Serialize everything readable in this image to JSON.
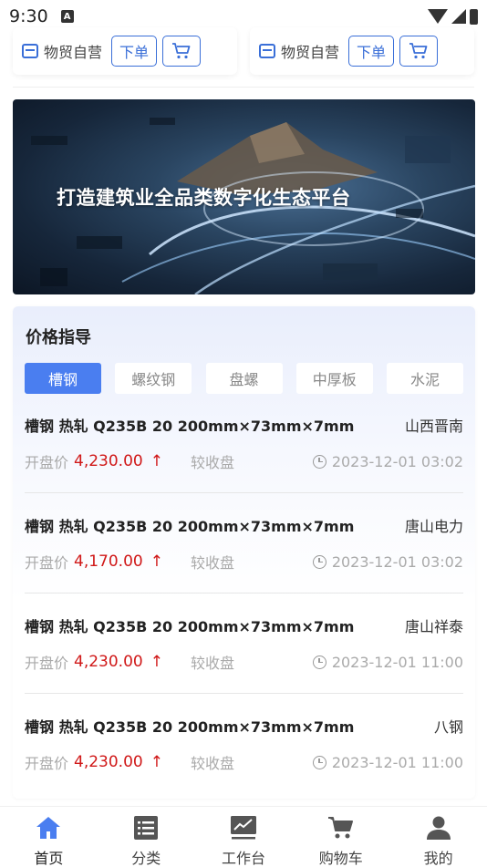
{
  "status_bar": {
    "time": "9:30",
    "notification_glyph": "A"
  },
  "top_cards": [
    {
      "shop_label": "物贸自营",
      "order_label": "下单"
    },
    {
      "shop_label": "物贸自营",
      "order_label": "下单"
    }
  ],
  "banner": {
    "title": "打造建筑业全品类数字化生态平台"
  },
  "price_guide": {
    "title": "价格指导",
    "tabs": [
      {
        "label": "槽钢",
        "active": true
      },
      {
        "label": "螺纹钢",
        "active": false
      },
      {
        "label": "盘螺",
        "active": false
      },
      {
        "label": "中厚板",
        "active": false
      },
      {
        "label": "水泥",
        "active": false
      }
    ],
    "open_label": "开盘价",
    "compare_label": "较收盘",
    "rows": [
      {
        "product": "槽钢 热轧 Q235B 20 200mm×73mm×7mm",
        "origin": "山西晋南",
        "price": "4,230.00",
        "trend": "↑",
        "time": "2023-12-01 03:02"
      },
      {
        "product": "槽钢 热轧 Q235B 20 200mm×73mm×7mm",
        "origin": "唐山电力",
        "price": "4,170.00",
        "trend": "↑",
        "time": "2023-12-01 03:02"
      },
      {
        "product": "槽钢 热轧 Q235B 20 200mm×73mm×7mm",
        "origin": "唐山祥泰",
        "price": "4,230.00",
        "trend": "↑",
        "time": "2023-12-01 11:00"
      },
      {
        "product": "槽钢 热轧 Q235B 20 200mm×73mm×7mm",
        "origin": "八钢",
        "price": "4,230.00",
        "trend": "↑",
        "time": "2023-12-01 11:00"
      }
    ]
  },
  "bottom_nav": [
    {
      "label": "首页",
      "icon": "home-icon",
      "active": true
    },
    {
      "label": "分类",
      "icon": "list-icon",
      "active": false
    },
    {
      "label": "工作台",
      "icon": "chart-icon",
      "active": false
    },
    {
      "label": "购物车",
      "icon": "cart-icon",
      "active": false
    },
    {
      "label": "我的",
      "icon": "user-icon",
      "active": false
    }
  ],
  "colors": {
    "accent": "#4a7ef0",
    "price_red": "#d01818"
  }
}
